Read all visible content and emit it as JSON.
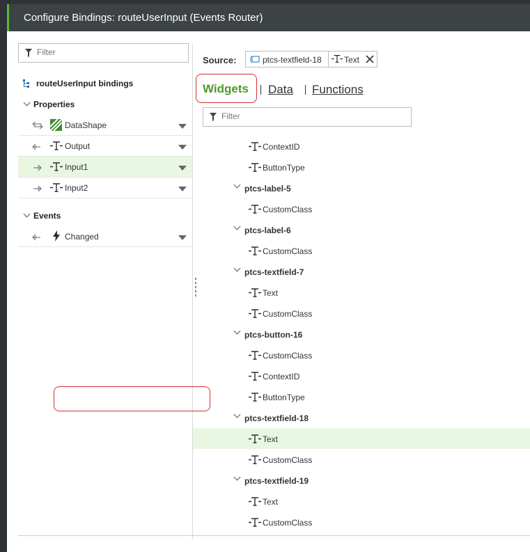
{
  "dialog": {
    "title": "Configure Bindings: routeUserInput (Events Router)"
  },
  "left_panel": {
    "filter_placeholder": "Filter",
    "root_label": "routeUserInput bindings",
    "properties_heading": "Properties",
    "properties": [
      {
        "label": "DataShape",
        "direction": "both"
      },
      {
        "label": "Output",
        "direction": "out"
      },
      {
        "label": "Input1",
        "direction": "in",
        "selected": true
      },
      {
        "label": "Input2",
        "direction": "in"
      }
    ],
    "events_heading": "Events",
    "events": [
      {
        "label": "Changed",
        "direction": "out"
      }
    ]
  },
  "source": {
    "label": "Source:",
    "widget": "ptcs-textfield-18",
    "property": "Text"
  },
  "tabs": {
    "widgets": "Widgets",
    "data": "Data",
    "functions": "Functions",
    "active": "widgets"
  },
  "right_filter_placeholder": "Filter",
  "tree": [
    {
      "kind": "prop",
      "label": "ContextID"
    },
    {
      "kind": "prop",
      "label": "ButtonType"
    },
    {
      "kind": "group",
      "label": "ptcs-label-5"
    },
    {
      "kind": "prop",
      "label": "CustomClass"
    },
    {
      "kind": "group",
      "label": "ptcs-label-6"
    },
    {
      "kind": "prop",
      "label": "CustomClass"
    },
    {
      "kind": "group",
      "label": "ptcs-textfield-7"
    },
    {
      "kind": "prop",
      "label": "Text"
    },
    {
      "kind": "prop",
      "label": "CustomClass"
    },
    {
      "kind": "group",
      "label": "ptcs-button-16"
    },
    {
      "kind": "prop",
      "label": "CustomClass"
    },
    {
      "kind": "prop",
      "label": "ContextID"
    },
    {
      "kind": "prop",
      "label": "ButtonType"
    },
    {
      "kind": "group",
      "label": "ptcs-textfield-18"
    },
    {
      "kind": "prop",
      "label": "Text",
      "selected": true
    },
    {
      "kind": "prop",
      "label": "CustomClass"
    },
    {
      "kind": "group",
      "label": "ptcs-textfield-19"
    },
    {
      "kind": "prop",
      "label": "Text"
    },
    {
      "kind": "prop",
      "label": "CustomClass"
    }
  ],
  "colors": {
    "accent": "#4c9a2a",
    "highlight": "#d32f2f",
    "selected_bg": "#e9f7e2",
    "titlebar": "#3d4345"
  },
  "icons": {
    "filter": "filter-icon",
    "bindings": "bindings-tree-icon",
    "datashape": "datashape-icon",
    "string_type": "text-type-icon",
    "event": "lightning-icon",
    "widget": "widget-icon",
    "close": "close-icon"
  }
}
